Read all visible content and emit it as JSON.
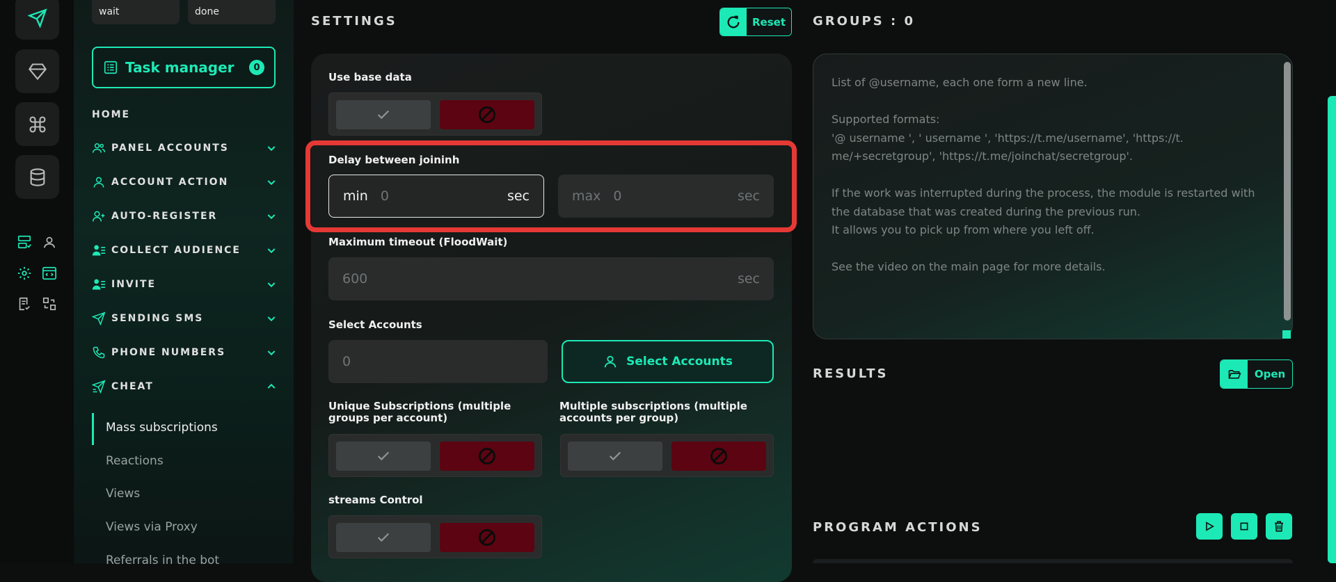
{
  "sidebar": {
    "status": {
      "left": "wait",
      "right": "done"
    },
    "task_manager": {
      "label": "Task manager",
      "count": "0"
    },
    "home": "HOME",
    "nav": [
      {
        "label": "PANEL ACCOUNTS",
        "icon": "users-icon"
      },
      {
        "label": "ACCOUNT ACTION",
        "icon": "user-icon"
      },
      {
        "label": "AUTO-REGISTER",
        "icon": "user-plus-icon"
      },
      {
        "label": "COLLECT AUDIENCE",
        "icon": "user-list-icon"
      },
      {
        "label": "INVITE",
        "icon": "user-list-icon"
      },
      {
        "label": "SENDING SMS",
        "icon": "send-icon"
      },
      {
        "label": "PHONE NUMBERS",
        "icon": "phone-icon"
      },
      {
        "label": "CHEAT",
        "icon": "send-fast-icon"
      }
    ],
    "cheat_sub": [
      "Mass subscriptions",
      "Reactions",
      "Views",
      "Views via Proxy",
      "Referrals in the bot"
    ]
  },
  "settings": {
    "title": "SETTINGS",
    "reset_label": "Reset",
    "use_base_data": "Use base data",
    "delay": {
      "label": "Delay between joininh",
      "min_prefix": "min",
      "min_value": "0",
      "min_suffix": "sec",
      "max_prefix": "max",
      "max_value": "0",
      "max_suffix": "sec"
    },
    "timeout": {
      "label": "Maximum timeout (FloodWait)",
      "value": "600",
      "suffix": "sec"
    },
    "select_accounts": {
      "label": "Select Accounts",
      "value": "0",
      "button": "Select Accounts"
    },
    "unique_subs": "Unique Subscriptions (multiple groups per account)",
    "multiple_subs": "Multiple subscriptions (multiple accounts per group)",
    "streams_control": "streams Control"
  },
  "groups": {
    "title": "GROUPS : 0",
    "placeholder": "List of @username, each one form a new line.\n\nSupported formats:\n'@ username ', ' username ', 'https://t.me/username', 'https://t. me/+secretgroup', 'https://t.me/joinchat/secretgroup'.\n\nIf the work was interrupted during the process, the module is restarted with the database that was created during the previous run.\nIt allows you to pick up from where you left off.\n\nSee the video on the main page for more details."
  },
  "results": {
    "title": "RESULTS",
    "open_label": "Open"
  },
  "program_actions": {
    "title": "PROGRAM ACTIONS"
  },
  "colors": {
    "accent": "#1de9b6",
    "danger": "#5c0411",
    "highlight": "#e53935"
  }
}
